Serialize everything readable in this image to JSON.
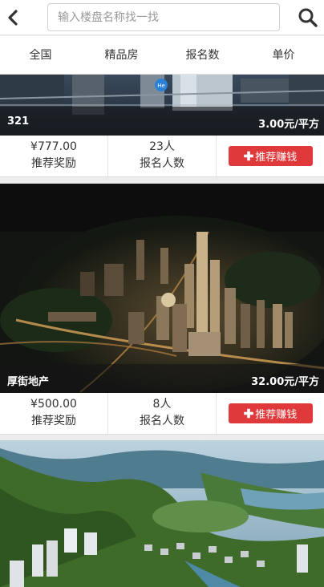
{
  "header": {
    "back_icon": "chevron-left-icon",
    "search_placeholder": "输入楼盘名称找一找",
    "search_icon": "search-icon"
  },
  "tabs": [
    {
      "label": "全国"
    },
    {
      "label": "精品房"
    },
    {
      "label": "报名数"
    },
    {
      "label": "单价"
    }
  ],
  "listings": [
    {
      "name": "321",
      "unit_price": "3.00元/平方",
      "reward": "¥777.00",
      "reward_label": "推荐奖励",
      "signups": "23人",
      "signups_label": "报名人数",
      "button_label": "推荐赚钱"
    },
    {
      "name": "厚街地产",
      "unit_price": "32.00元/平方",
      "reward": "¥500.00",
      "reward_label": "推荐奖励",
      "signups": "8人",
      "signups_label": "报名人数",
      "button_label": "推荐赚钱"
    }
  ],
  "colors": {
    "accent_red": "#e0393b",
    "caption_overlay": "#141414"
  }
}
